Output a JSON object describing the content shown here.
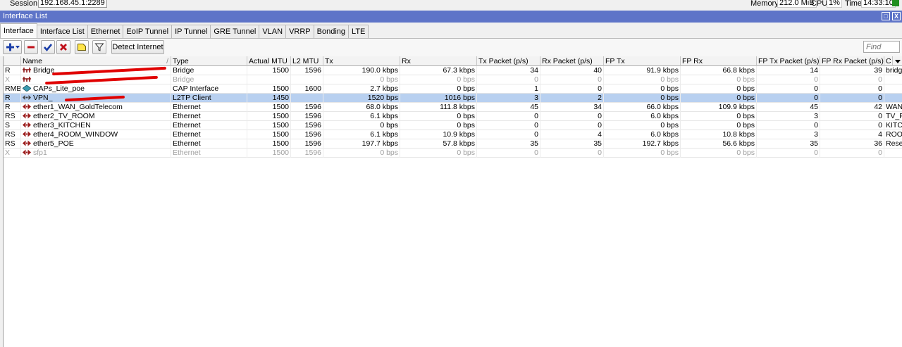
{
  "status": {
    "session_label": "Session:",
    "session_value": "192.168.45.1:2289",
    "memory_label": "Memory:",
    "memory_value": "212.0 MiB",
    "cpu_label": "CPU:",
    "cpu_value": "1%",
    "time_label": "Time:",
    "time_value": "14:33:10"
  },
  "window": {
    "title": "Interface List",
    "maximize_glyph": "□",
    "close_glyph": "X"
  },
  "tabs": [
    "Interface",
    "Interface List",
    "Ethernet",
    "EoIP Tunnel",
    "IP Tunnel",
    "GRE Tunnel",
    "VLAN",
    "VRRP",
    "Bonding",
    "LTE"
  ],
  "toolbar": {
    "detect_label": "Detect Internet",
    "find_placeholder": "Find"
  },
  "columns": [
    "",
    "Name",
    "Type",
    "Actual MTU",
    "L2 MTU",
    "Tx",
    "Rx",
    "Tx Packet (p/s)",
    "Rx Packet (p/s)",
    "FP Tx",
    "FP Rx",
    "FP Tx Packet (p/s)",
    "FP Rx Packet (p/s)",
    "C"
  ],
  "rows": [
    {
      "flags": "R",
      "icon": "bridge-icon",
      "name": "Bridge",
      "type": "Bridge",
      "mtu": "1500",
      "l2mtu": "1596",
      "tx": "190.0 kbps",
      "rx": "67.3 kbps",
      "txp": "34",
      "rxp": "40",
      "fptx": "91.9 kbps",
      "fprx": "66.8 kbps",
      "fptxp": "14",
      "fprxp": "39",
      "c": "bridg"
    },
    {
      "flags": "X",
      "icon": "bridge-icon",
      "name": "",
      "type": "Bridge",
      "mtu": "",
      "l2mtu": "",
      "tx": "0 bps",
      "rx": "0 bps",
      "txp": "0",
      "rxp": "0",
      "fptx": "0 bps",
      "fprx": "0 bps",
      "fptxp": "0",
      "fprxp": "0",
      "c": ""
    },
    {
      "flags": "RMB",
      "icon": "cap-icon",
      "name": "CAPs_Lite_poe",
      "type": "CAP Interface",
      "mtu": "1500",
      "l2mtu": "1600",
      "tx": "2.7 kbps",
      "rx": "0 bps",
      "txp": "1",
      "rxp": "0",
      "fptx": "0 bps",
      "fprx": "0 bps",
      "fptxp": "0",
      "fprxp": "0",
      "c": ""
    },
    {
      "flags": "R",
      "icon": "vpn-icon",
      "name": "VPN_",
      "type": "L2TP Client",
      "mtu": "1450",
      "l2mtu": "",
      "tx": "1520 bps",
      "rx": "1016 bps",
      "txp": "3",
      "rxp": "2",
      "fptx": "0 bps",
      "fprx": "0 bps",
      "fptxp": "0",
      "fprxp": "0",
      "c": ""
    },
    {
      "flags": "R",
      "icon": "ethernet-icon",
      "name": "ether1_WAN_GoldTelecom",
      "type": "Ethernet",
      "mtu": "1500",
      "l2mtu": "1596",
      "tx": "68.0 kbps",
      "rx": "111.8 kbps",
      "txp": "45",
      "rxp": "34",
      "fptx": "66.0 kbps",
      "fprx": "109.9 kbps",
      "fptxp": "45",
      "fprxp": "42",
      "c": "WAN"
    },
    {
      "flags": "RS",
      "icon": "ethernet-icon",
      "name": "ether2_TV_ROOM",
      "type": "Ethernet",
      "mtu": "1500",
      "l2mtu": "1596",
      "tx": "6.1 kbps",
      "rx": "0 bps",
      "txp": "0",
      "rxp": "0",
      "fptx": "6.0 kbps",
      "fprx": "0 bps",
      "fptxp": "3",
      "fprxp": "0",
      "c": "TV_F"
    },
    {
      "flags": "S",
      "icon": "ethernet-icon",
      "name": "ether3_KITCHEN",
      "type": "Ethernet",
      "mtu": "1500",
      "l2mtu": "1596",
      "tx": "0 bps",
      "rx": "0 bps",
      "txp": "0",
      "rxp": "0",
      "fptx": "0 bps",
      "fprx": "0 bps",
      "fptxp": "0",
      "fprxp": "0",
      "c": "KITC"
    },
    {
      "flags": "RS",
      "icon": "ethernet-icon",
      "name": "ether4_ROOM_WINDOW",
      "type": "Ethernet",
      "mtu": "1500",
      "l2mtu": "1596",
      "tx": "6.1 kbps",
      "rx": "10.9 kbps",
      "txp": "0",
      "rxp": "4",
      "fptx": "6.0 kbps",
      "fprx": "10.8 kbps",
      "fptxp": "3",
      "fprxp": "4",
      "c": "ROO"
    },
    {
      "flags": "RS",
      "icon": "ethernet-icon",
      "name": "ether5_POE",
      "type": "Ethernet",
      "mtu": "1500",
      "l2mtu": "1596",
      "tx": "197.7 kbps",
      "rx": "57.8 kbps",
      "txp": "35",
      "rxp": "35",
      "fptx": "192.7 kbps",
      "fprx": "56.6 kbps",
      "fptxp": "35",
      "fprxp": "36",
      "c": "Rese"
    },
    {
      "flags": "X",
      "icon": "ethernet-icon",
      "name": "sfp1",
      "type": "Ethernet",
      "mtu": "1500",
      "l2mtu": "1596",
      "tx": "0 bps",
      "rx": "0 bps",
      "txp": "0",
      "rxp": "0",
      "fptx": "0 bps",
      "fprx": "0 bps",
      "fptxp": "0",
      "fprxp": "0",
      "c": ""
    }
  ],
  "colors": {
    "title_bar": "#5e74c8",
    "selected_row": "#b8d0f0",
    "redaction": "#e00000",
    "status_led": "#1f8f1f"
  }
}
